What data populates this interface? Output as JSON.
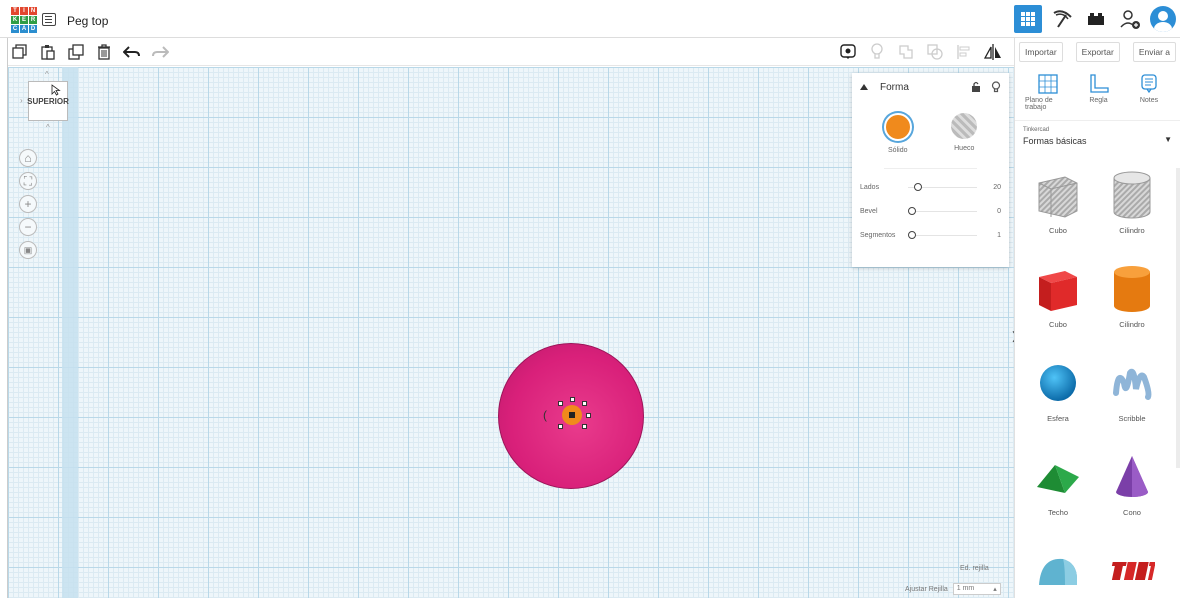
{
  "app": {
    "title": "Peg top",
    "logo_letters": [
      "T",
      "I",
      "N",
      "K",
      "E",
      "R",
      "C",
      "A",
      "D"
    ]
  },
  "toolbar": {
    "left_tools": [
      "copy-icon",
      "paste-icon",
      "duplicate-icon",
      "trash-icon",
      "undo-icon",
      "redo-icon"
    ],
    "right_tools": [
      "notes-view-icon",
      "light-bulb-icon",
      "group-icon",
      "ungroup-icon",
      "align-icon",
      "mirror-icon"
    ]
  },
  "viewcube": {
    "label": "SUPERIOR"
  },
  "shape_panel": {
    "title": "Forma",
    "solid_label": "Sólido",
    "hole_label": "Hueco",
    "solid_color": "#f08a1c",
    "params": [
      {
        "label": "Lados",
        "value": "20",
        "fraction": 0.08
      },
      {
        "label": "Bevel",
        "value": "0",
        "fraction": 0.0
      },
      {
        "label": "Segmentos",
        "value": "1",
        "fraction": 0.0
      }
    ]
  },
  "right_panel": {
    "buttons": [
      "Importar",
      "Exportar",
      "Enviar a"
    ],
    "tools": [
      {
        "label": "Plano de trabajo",
        "icon": "workplane-icon"
      },
      {
        "label": "Regla",
        "icon": "ruler-icon"
      },
      {
        "label": "Notes",
        "icon": "notes-icon"
      }
    ],
    "library_source": "Tinkercad",
    "library_name": "Formas básicas",
    "shapes": [
      {
        "label": "Cubo",
        "icon": "cube-hole-icon"
      },
      {
        "label": "Cilindro",
        "icon": "cylinder-hole-icon"
      },
      {
        "label": "Cubo",
        "icon": "cube-red-icon"
      },
      {
        "label": "Cilindro",
        "icon": "cylinder-orange-icon"
      },
      {
        "label": "Esfera",
        "icon": "sphere-blue-icon"
      },
      {
        "label": "Scribble",
        "icon": "scribble-icon"
      },
      {
        "label": "Techo",
        "icon": "roof-green-icon"
      },
      {
        "label": "Cono",
        "icon": "cone-purple-icon"
      },
      {
        "label": "",
        "icon": "half-cylinder-icon"
      },
      {
        "label": "",
        "icon": "text-3d-icon"
      }
    ]
  },
  "grid": {
    "edit_label": "Ed. rejilla",
    "snap_label": "Ajustar Rejilla",
    "snap_value": "1 mm"
  },
  "colors": {
    "accent": "#2c8ed6",
    "sphere": "#d9207a",
    "peg": "#f08a1c"
  }
}
